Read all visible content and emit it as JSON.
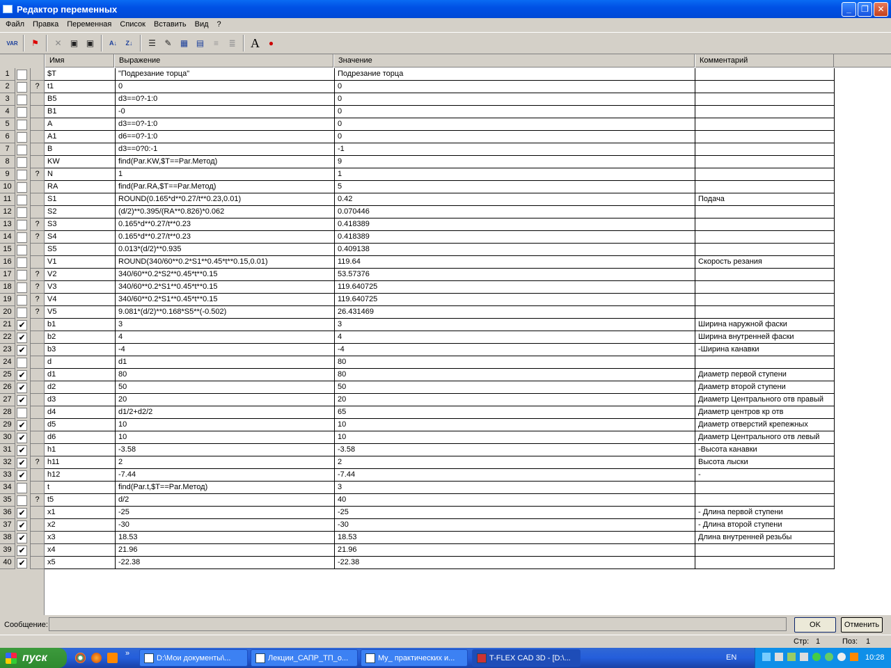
{
  "window": {
    "title": "Редактор переменных"
  },
  "menu": [
    "Файл",
    "Правка",
    "Переменная",
    "Список",
    "Вставить",
    "Вид",
    "?"
  ],
  "columns": {
    "name": "Имя",
    "expr": "Выражение",
    "value": "Значение",
    "comment": "Комментарий"
  },
  "rows": [
    {
      "n": "1",
      "c": "",
      "q": "",
      "name": "$T",
      "expr": "\"Подрезание торца\"",
      "value": "Подрезание торца",
      "comment": ""
    },
    {
      "n": "2",
      "c": "",
      "q": "?",
      "name": "t1",
      "expr": "0",
      "value": "0",
      "comment": ""
    },
    {
      "n": "3",
      "c": "",
      "q": "",
      "name": "B5",
      "expr": "d3==0?-1:0",
      "value": "0",
      "comment": ""
    },
    {
      "n": "4",
      "c": "",
      "q": "",
      "name": "B1",
      "expr": "-0",
      "value": "0",
      "comment": ""
    },
    {
      "n": "5",
      "c": "",
      "q": "",
      "name": "A",
      "expr": "d3==0?-1:0",
      "value": "0",
      "comment": ""
    },
    {
      "n": "6",
      "c": "",
      "q": "",
      "name": "A1",
      "expr": "d6==0?-1:0",
      "value": "0",
      "comment": ""
    },
    {
      "n": "7",
      "c": "",
      "q": "",
      "name": "B",
      "expr": "d3==0?0:-1",
      "value": "-1",
      "comment": ""
    },
    {
      "n": "8",
      "c": "",
      "q": "",
      "name": "KW",
      "expr": "find(Par.KW,$T==Par.Метод)",
      "value": "9",
      "comment": ""
    },
    {
      "n": "9",
      "c": "",
      "q": "?",
      "name": "N",
      "expr": "1",
      "value": "1",
      "comment": ""
    },
    {
      "n": "10",
      "c": "",
      "q": "",
      "name": "RA",
      "expr": "find(Par.RA,$T==Par.Метод)",
      "value": "5",
      "comment": ""
    },
    {
      "n": "11",
      "c": "",
      "q": "",
      "name": "S1",
      "expr": "ROUND(0.165*d**0.27/t**0.23,0.01)",
      "value": "0.42",
      "comment": "Подача"
    },
    {
      "n": "12",
      "c": "",
      "q": "",
      "name": "S2",
      "expr": "(d/2)**0.395/(RA**0.826)*0.062",
      "value": "0.070446",
      "comment": ""
    },
    {
      "n": "13",
      "c": "",
      "q": "?",
      "name": "S3",
      "expr": "0.165*d**0.27/t**0.23",
      "value": "0.418389",
      "comment": ""
    },
    {
      "n": "14",
      "c": "",
      "q": "?",
      "name": "S4",
      "expr": "0.165*d**0.27/t**0.23",
      "value": "0.418389",
      "comment": ""
    },
    {
      "n": "15",
      "c": "",
      "q": "",
      "name": "S5",
      "expr": "0.013*(d/2)**0.935",
      "value": "0.409138",
      "comment": ""
    },
    {
      "n": "16",
      "c": "",
      "q": "",
      "name": "V1",
      "expr": "ROUND(340/60**0.2*S1**0.45*t**0.15,0.01)",
      "value": "119.64",
      "comment": "Скорость резания"
    },
    {
      "n": "17",
      "c": "",
      "q": "?",
      "name": "V2",
      "expr": "340/60**0.2*S2**0.45*t**0.15",
      "value": "53.57376",
      "comment": ""
    },
    {
      "n": "18",
      "c": "",
      "q": "?",
      "name": "V3",
      "expr": "340/60**0.2*S1**0.45*t**0.15",
      "value": "119.640725",
      "comment": ""
    },
    {
      "n": "19",
      "c": "",
      "q": "?",
      "name": "V4",
      "expr": "340/60**0.2*S1**0.45*t**0.15",
      "value": "119.640725",
      "comment": ""
    },
    {
      "n": "20",
      "c": "",
      "q": "?",
      "name": "V5",
      "expr": "9.081*(d/2)**0.168*S5**(-0.502)",
      "value": "26.431469",
      "comment": ""
    },
    {
      "n": "21",
      "c": "✔",
      "q": "",
      "name": "b1",
      "expr": "3",
      "value": "3",
      "comment": "Ширина наружной фаски"
    },
    {
      "n": "22",
      "c": "✔",
      "q": "",
      "name": "b2",
      "expr": "4",
      "value": "4",
      "comment": "Ширина внутренней фаски"
    },
    {
      "n": "23",
      "c": "✔",
      "q": "",
      "name": "b3",
      "expr": "-4",
      "value": "-4",
      "comment": "-Ширина канавки"
    },
    {
      "n": "24",
      "c": "",
      "q": "",
      "name": "d",
      "expr": "d1",
      "value": "80",
      "comment": ""
    },
    {
      "n": "25",
      "c": "✔",
      "q": "",
      "name": "d1",
      "expr": "80",
      "value": "80",
      "comment": "Диаметр первой ступени"
    },
    {
      "n": "26",
      "c": "✔",
      "q": "",
      "name": "d2",
      "expr": "50",
      "value": "50",
      "comment": "Диаметр второй ступени"
    },
    {
      "n": "27",
      "c": "✔",
      "q": "",
      "name": "d3",
      "expr": "20",
      "value": "20",
      "comment": "Диаметр Центрального отв правый"
    },
    {
      "n": "28",
      "c": "",
      "q": "",
      "name": "d4",
      "expr": "d1/2+d2/2",
      "value": "65",
      "comment": "Диаметр центров кр отв"
    },
    {
      "n": "29",
      "c": "✔",
      "q": "",
      "name": "d5",
      "expr": "10",
      "value": "10",
      "comment": "Диаметр отверстий крепежных"
    },
    {
      "n": "30",
      "c": "✔",
      "q": "",
      "name": "d6",
      "expr": "10",
      "value": "10",
      "comment": "Диаметр Центрального отв левый"
    },
    {
      "n": "31",
      "c": "✔",
      "q": "",
      "name": "h1",
      "expr": "-3.58",
      "value": "-3.58",
      "comment": "-Высота канавки"
    },
    {
      "n": "32",
      "c": "✔",
      "q": "?",
      "name": "h11",
      "expr": "2",
      "value": "2",
      "comment": "Высота лыски"
    },
    {
      "n": "33",
      "c": "✔",
      "q": "",
      "name": "h12",
      "expr": "-7.44",
      "value": "-7.44",
      "comment": "-"
    },
    {
      "n": "34",
      "c": "",
      "q": "",
      "name": "t",
      "expr": "find(Par.t,$T==Par.Метод)",
      "value": "3",
      "comment": ""
    },
    {
      "n": "35",
      "c": "",
      "q": "?",
      "name": "t5",
      "expr": "d/2",
      "value": "40",
      "comment": ""
    },
    {
      "n": "36",
      "c": "✔",
      "q": "",
      "name": "x1",
      "expr": "-25",
      "value": "-25",
      "comment": "- Длина первой ступени"
    },
    {
      "n": "37",
      "c": "✔",
      "q": "",
      "name": "x2",
      "expr": "-30",
      "value": "-30",
      "comment": "- Длина второй ступени"
    },
    {
      "n": "38",
      "c": "✔",
      "q": "",
      "name": "x3",
      "expr": "18.53",
      "value": "18.53",
      "comment": "Длина внутренней резьбы"
    },
    {
      "n": "39",
      "c": "✔",
      "q": "",
      "name": "x4",
      "expr": "21.96",
      "value": "21.96",
      "comment": ""
    },
    {
      "n": "40",
      "c": "✔",
      "q": "",
      "name": "x5",
      "expr": "-22.38",
      "value": "-22.38",
      "comment": ""
    }
  ],
  "footer": {
    "message_label": "Сообщение:",
    "ok": "OK",
    "cancel": "Отменить",
    "page_label": "Стр:",
    "page": "1",
    "pos_label": "Поз:",
    "pos": "1"
  },
  "taskbar": {
    "start": "пуск",
    "tasks": [
      "D:\\Мои документы\\...",
      "Лекции_САПР_ТП_о...",
      "My_ практических и...",
      "T-FLEX CAD 3D - [D:\\..."
    ],
    "lang": "EN",
    "time": "10:28"
  }
}
